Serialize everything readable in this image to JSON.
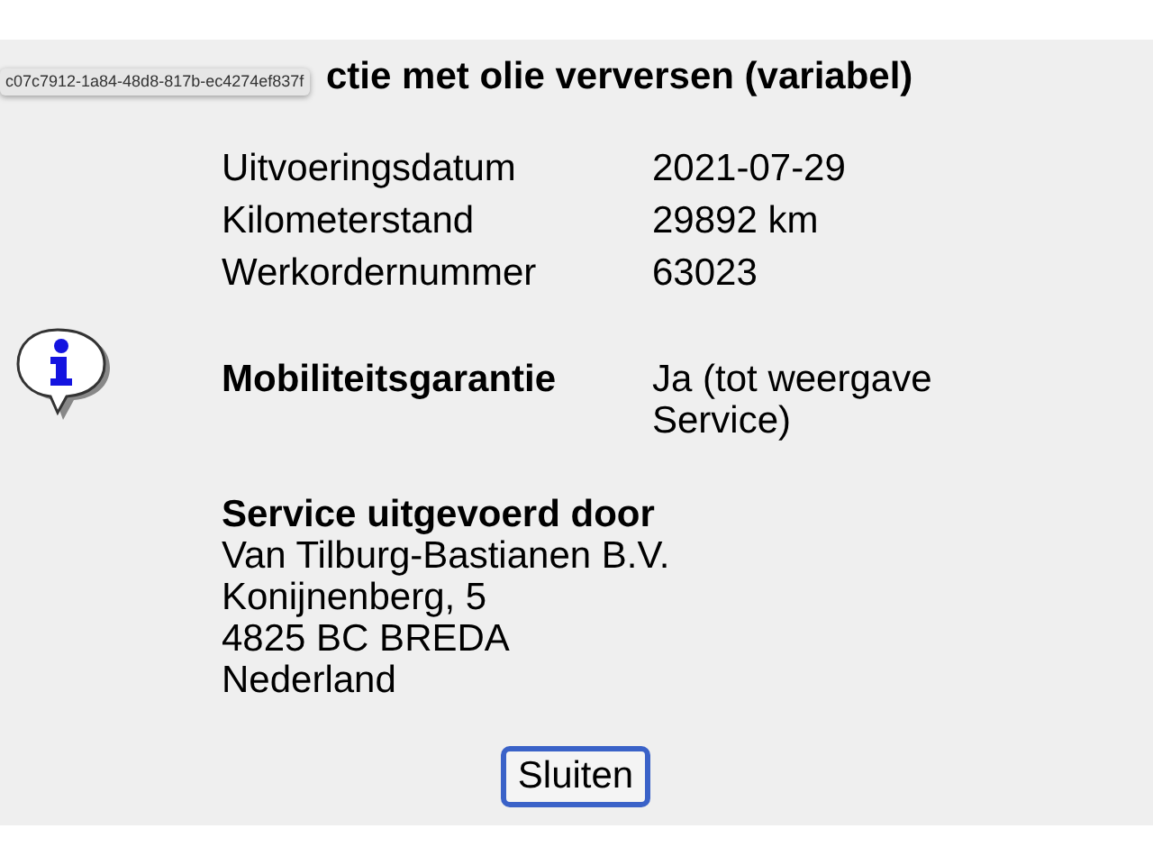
{
  "tooltip": "c07c7912-1a84-48d8-817b-ec4274ef837f",
  "title": "ctie met olie verversen (variabel)",
  "details": [
    {
      "label": "Uitvoeringsdatum",
      "value": "2021-07-29"
    },
    {
      "label": "Kilometerstand",
      "value": "29892 km"
    },
    {
      "label": "Werkordernummer",
      "value": "63023"
    }
  ],
  "guarantee": {
    "label": "Mobiliteitsgarantie",
    "value": "Ja (tot weergave Service)"
  },
  "service": {
    "heading": "Service uitgevoerd door",
    "lines": [
      "Van Tilburg-Bastianen B.V.",
      "Konijnenberg, 5",
      "4825 BC BREDA",
      "Nederland"
    ]
  },
  "button": "Sluiten"
}
